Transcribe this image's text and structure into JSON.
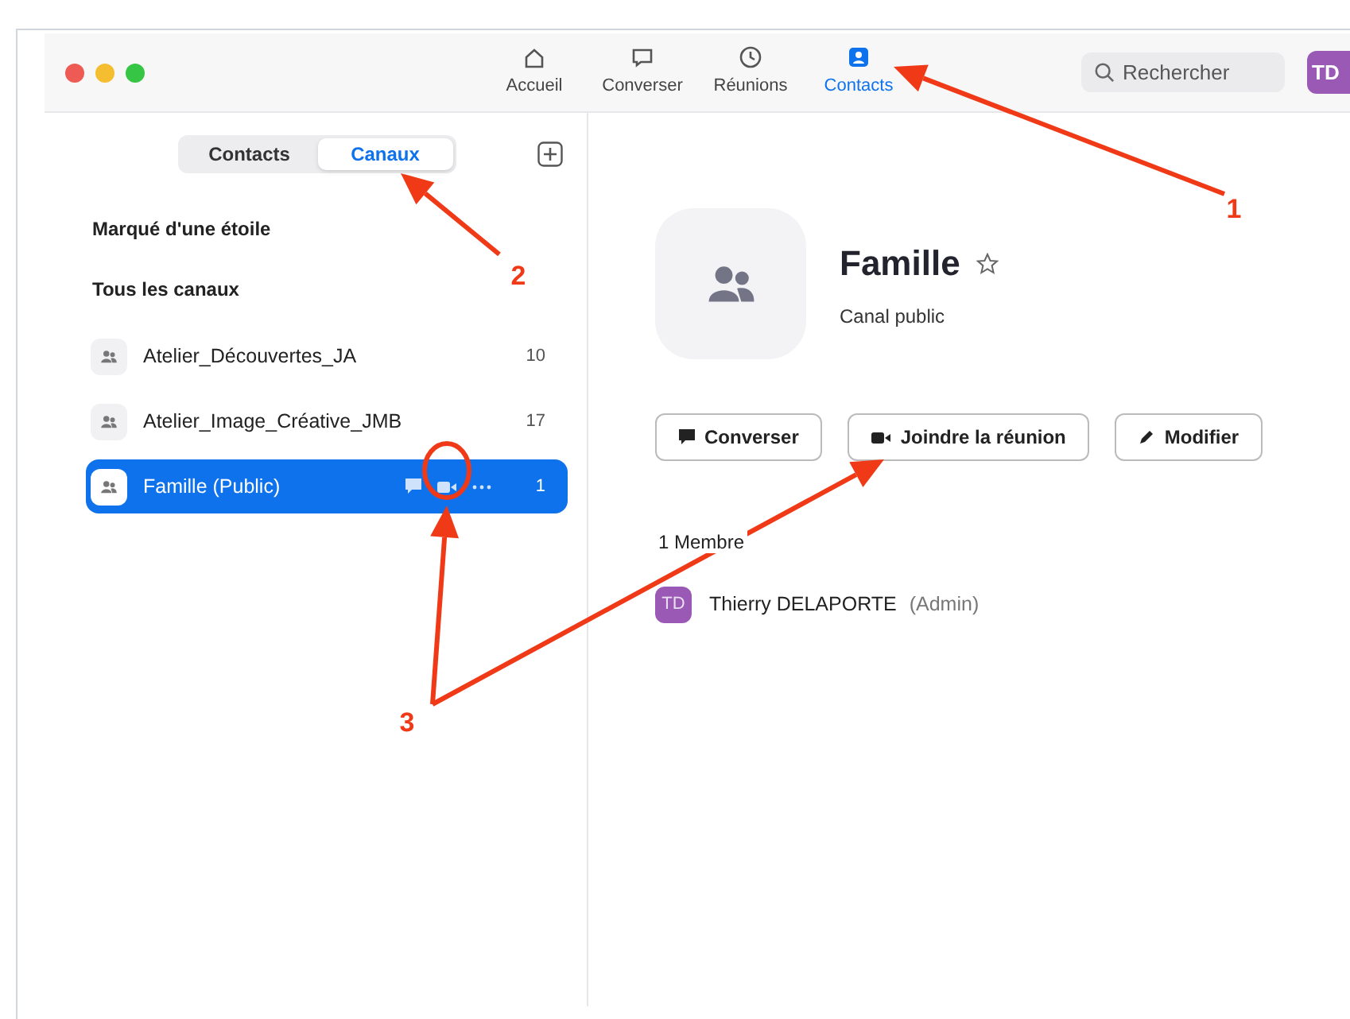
{
  "toolbar": {
    "tabs": [
      {
        "label": "Accueil",
        "selected": false
      },
      {
        "label": "Converser",
        "selected": false
      },
      {
        "label": "Réunions",
        "selected": false
      },
      {
        "label": "Contacts",
        "selected": true
      }
    ],
    "search": {
      "placeholder": "Rechercher"
    },
    "avatar": "TD"
  },
  "sidebar": {
    "segments": [
      {
        "label": "Contacts",
        "selected": false
      },
      {
        "label": "Canaux",
        "selected": true
      }
    ],
    "sections": [
      "Marqué d'une étoile",
      "Tous les canaux"
    ],
    "channels": [
      {
        "name": "Atelier_Découvertes_JA",
        "count": "10",
        "selected": false
      },
      {
        "name": "Atelier_Image_Créative_JMB",
        "count": "17",
        "selected": false
      },
      {
        "name": "Famille (Public)",
        "count": "1",
        "selected": true
      }
    ]
  },
  "detail": {
    "title": "Famille",
    "subtitle": "Canal public",
    "buttons": [
      "Converser",
      "Joindre la réunion",
      "Modifier"
    ],
    "members_heading": "1 Membre",
    "members": [
      {
        "initials": "TD",
        "name": "Thierry DELAPORTE",
        "role": "(Admin)"
      }
    ]
  },
  "annotations": [
    {
      "label": "1"
    },
    {
      "label": "2"
    },
    {
      "label": "3"
    }
  ]
}
